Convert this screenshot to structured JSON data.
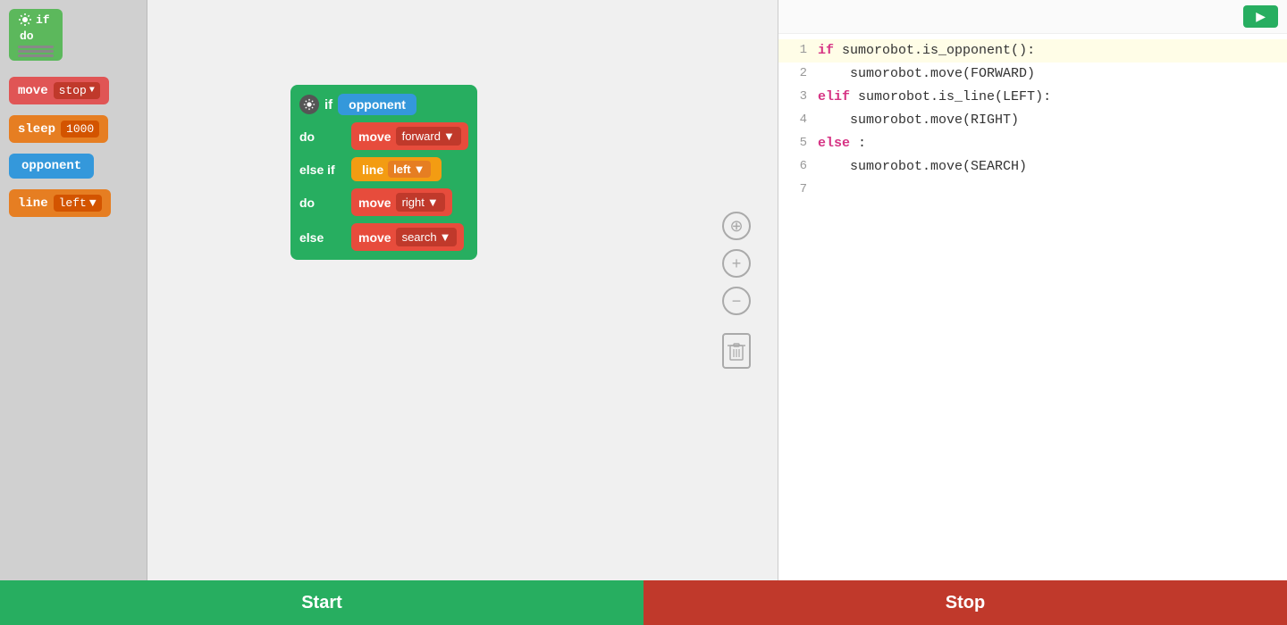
{
  "sidebar": {
    "move_label": "move",
    "move_stop_value": "stop",
    "sleep_label": "sleep",
    "sleep_value": "1000",
    "opponent_label": "opponent",
    "line_label": "line",
    "line_left_value": "left"
  },
  "canvas": {
    "if_label": "if",
    "do_label": "do",
    "else_if_label": "else if",
    "else_label": "else",
    "opponent_cond": "opponent",
    "move_forward_label": "move",
    "move_forward_value": "forward",
    "line_left_label": "line",
    "line_left_value": "left",
    "move_right_label": "move",
    "move_right_value": "right",
    "move_search_label": "move",
    "move_search_value": "search"
  },
  "code": {
    "line1": "if sumorobot.is_opponent():",
    "line2": "    sumorobot.move(FORWARD)",
    "line3": "elif sumorobot.is_line(LEFT):",
    "line4": "    sumorobot.move(RIGHT)",
    "line5": "else:",
    "line6": "    sumorobot.move(SEARCH)",
    "line7": "",
    "run_button": "▶"
  },
  "footer": {
    "start_label": "Start",
    "stop_label": "Stop"
  },
  "controls": {
    "crosshair": "⊕",
    "plus": "+",
    "minus": "−",
    "trash": "🗑"
  }
}
